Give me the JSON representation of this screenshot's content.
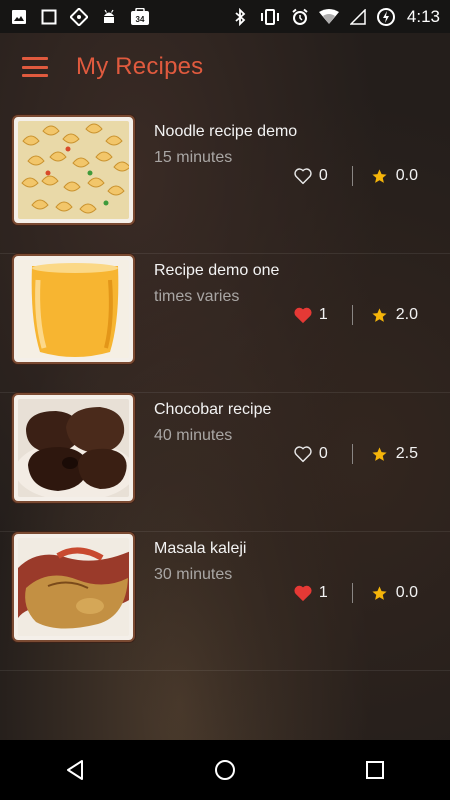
{
  "status_bar": {
    "time": "4:13",
    "left_icons": [
      "image-icon",
      "square-icon",
      "location-icon",
      "android-icon",
      "notification-count-icon"
    ],
    "notification_count": "34",
    "right_icons": [
      "bluetooth-icon",
      "vibrate-icon",
      "alarm-icon",
      "wifi-icon",
      "signal-icon",
      "battery-icon"
    ]
  },
  "app_bar": {
    "title": "My Recipes",
    "menu_icon": "hamburger-menu-icon",
    "accent_color": "#e05a3e"
  },
  "recipes": [
    {
      "name": "Noodle recipe demo",
      "time": "15 minutes",
      "likes": "0",
      "liked": false,
      "rating": "0.0",
      "image": "pasta"
    },
    {
      "name": "Recipe demo one",
      "time": "times varies",
      "likes": "1",
      "liked": true,
      "rating": "2.0",
      "image": "juice"
    },
    {
      "name": "Chocobar recipe",
      "time": "40 minutes",
      "likes": "0",
      "liked": false,
      "rating": "2.5",
      "image": "chocolate"
    },
    {
      "name": "Masala kaleji",
      "time": "30 minutes",
      "likes": "1",
      "liked": true,
      "rating": "0.0",
      "image": "kaleji"
    }
  ],
  "colors": {
    "heart_filled": "#e53935",
    "star": "#f5b50a"
  },
  "nav_bar": {
    "buttons": [
      "back-icon",
      "home-icon",
      "recents-icon"
    ]
  }
}
